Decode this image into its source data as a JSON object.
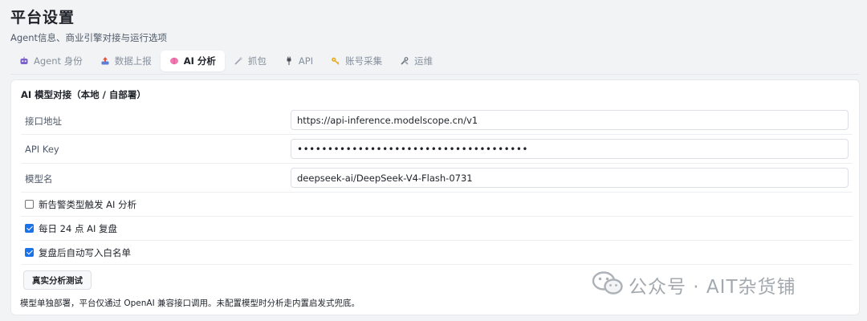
{
  "header": {
    "title": "平台设置",
    "subtitle": "Agent信息、商业引擎对接与运行选项"
  },
  "tabs": [
    {
      "label": "Agent 身份",
      "icon": "robot-icon",
      "active": false
    },
    {
      "label": "数据上报",
      "icon": "upload-icon",
      "active": false
    },
    {
      "label": "AI 分析",
      "icon": "brain-icon",
      "active": true
    },
    {
      "label": "抓包",
      "icon": "needle-icon",
      "active": false
    },
    {
      "label": "API",
      "icon": "plug-icon",
      "active": false
    },
    {
      "label": "账号采集",
      "icon": "key-icon",
      "active": false
    },
    {
      "label": "运维",
      "icon": "tools-icon",
      "active": false
    }
  ],
  "card": {
    "title": "AI 模型对接（本地 / 自部署）",
    "fields": [
      {
        "label": "接口地址",
        "value": "https://api-inference.modelscope.cn/v1"
      },
      {
        "label": "API Key",
        "value": "••••••••••••••••••••••••••••••••••••••"
      },
      {
        "label": "模型名",
        "value": "deepseek-ai/DeepSeek-V4-Flash-0731"
      }
    ],
    "options": [
      {
        "label": "新告警类型触发 AI 分析",
        "checked": false
      },
      {
        "label": "每日 24 点 AI 复盘",
        "checked": true
      },
      {
        "label": "复盘后自动写入白名单",
        "checked": true
      }
    ],
    "test_button": "真实分析测试",
    "footnote": "模型单独部署，平台仅通过 OpenAI 兼容接口调用。未配置模型时分析走内置启发式兜底。"
  },
  "watermark": {
    "text": "公众号 · AIT杂货铺",
    "icon": "wechat-icon"
  },
  "colors": {
    "accent": "#1a73e8",
    "background": "#f2f3f5"
  }
}
